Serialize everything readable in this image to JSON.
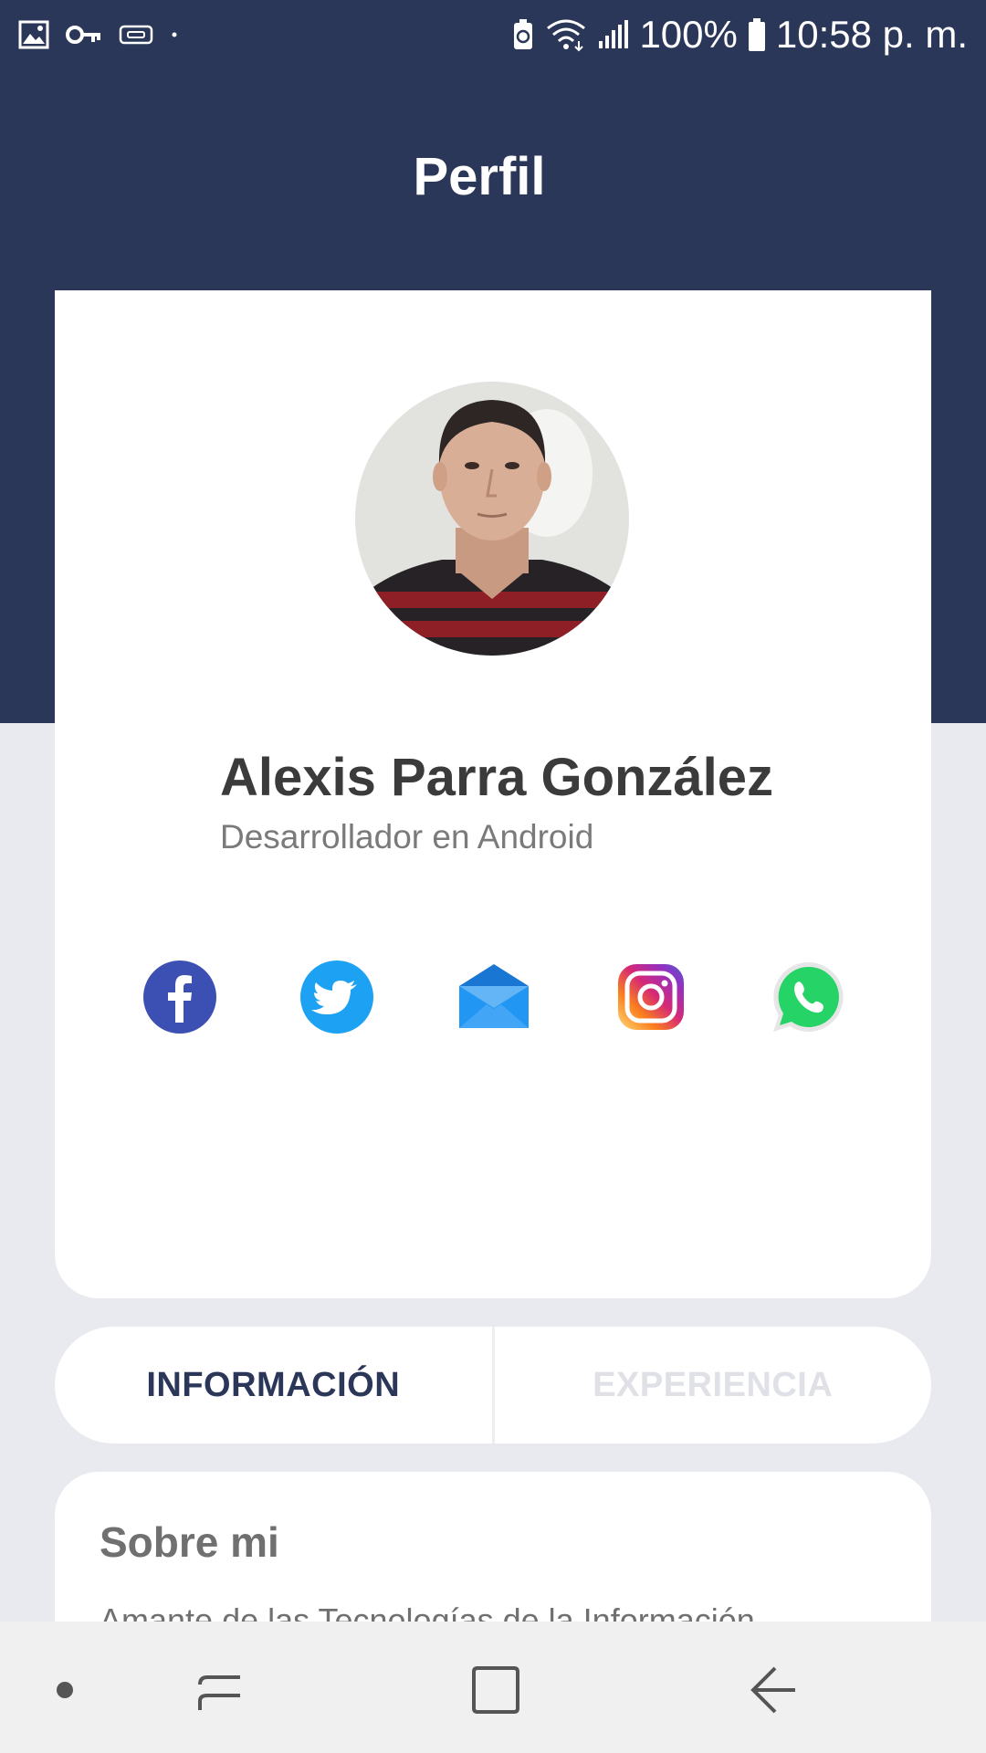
{
  "status_bar": {
    "battery": "100%",
    "time": "10:58 p. m."
  },
  "header": {
    "title": "Perfil"
  },
  "profile": {
    "name": "Alexis Parra González",
    "role": "Desarrollador en Android",
    "social": [
      {
        "name": "facebook",
        "color": "#3b50b2"
      },
      {
        "name": "twitter",
        "color": "#1da1f2"
      },
      {
        "name": "email",
        "color": "#2196f3"
      },
      {
        "name": "instagram",
        "color": "#e1306c"
      },
      {
        "name": "whatsapp",
        "color": "#25d366"
      }
    ]
  },
  "tabs": [
    {
      "label": "INFORMACIÓN",
      "active": true
    },
    {
      "label": "EXPERIENCIA",
      "active": false
    }
  ],
  "about": {
    "title": "Sobre mi",
    "text": "Amante de las Tecnologías de la Información"
  },
  "colors": {
    "primary": "#2b3758",
    "background": "#e9eaef",
    "card": "#ffffff"
  }
}
